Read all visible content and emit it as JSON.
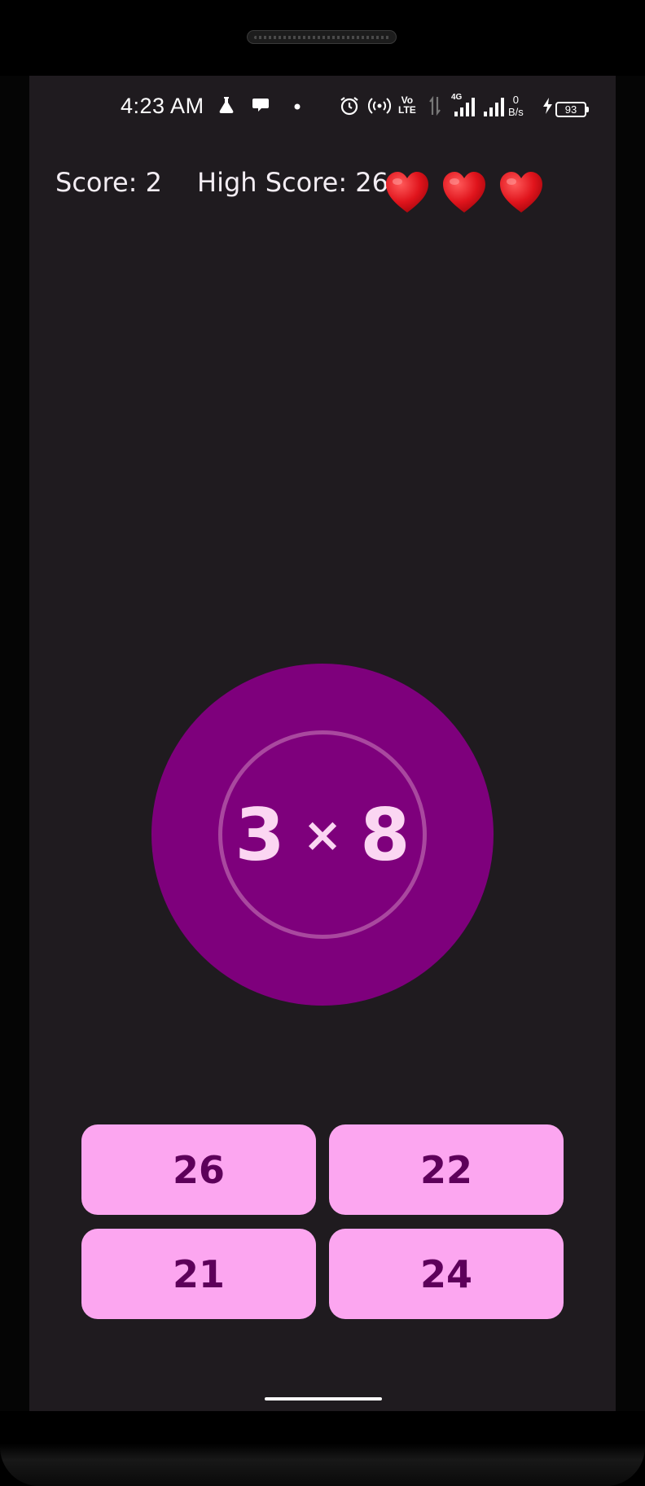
{
  "status_bar": {
    "time": "4:23 AM",
    "network_type": "4G",
    "volte_line1": "Vo",
    "volte_line2": "LTE",
    "speed_value": "0",
    "speed_unit": "B/s",
    "battery": "93",
    "icons": [
      "flask-icon",
      "chat-bubble-icon",
      "notification-dot-icon",
      "alarm-icon",
      "hotspot-icon",
      "data-arrows-icon",
      "signal-icon",
      "charging-icon",
      "battery-icon"
    ]
  },
  "game": {
    "score_label": "Score: 2",
    "high_score_label": "High Score: 26",
    "lives": 3,
    "lives_icon": "heart-icon",
    "problem": {
      "left": "3",
      "operator": "×",
      "right": "8"
    },
    "answers": [
      "26",
      "22",
      "21",
      "24"
    ]
  },
  "colors": {
    "background": "#1f1b1f",
    "circle": "#7e007c",
    "circle_ring": "#a9489f",
    "problem_text": "#fbd6f2",
    "answer_bg": "#fca6f0",
    "answer_text": "#5d005a",
    "heart": "#e0141c"
  }
}
